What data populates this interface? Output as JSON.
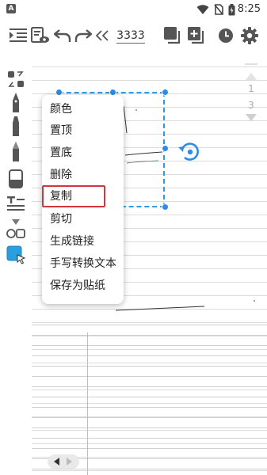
{
  "status_bar": {
    "app_badge": "A",
    "time": "8:25",
    "icons": [
      "wifi-icon",
      "no-sim-icon",
      "battery-icon"
    ]
  },
  "toolbar": {
    "page_number": "3333",
    "icons": [
      "toc-icon",
      "eye-icon",
      "undo-icon",
      "redo-icon",
      "collapse-icon",
      "copy-page-icon",
      "add-page-icon",
      "clock-icon",
      "gear-icon"
    ]
  },
  "tools": [
    "lasso-icon",
    "pen-icon",
    "marker-icon",
    "highlighter-icon",
    "eraser-icon",
    "text-tool-icon",
    "shapes-icon",
    "select-icon"
  ],
  "pager": {
    "top": "1",
    "bottom": "3"
  },
  "context_menu": {
    "items": [
      {
        "label": "颜色"
      },
      {
        "label": "置顶"
      },
      {
        "label": "置底"
      },
      {
        "label": "删除"
      },
      {
        "label": "复制",
        "highlighted": true
      },
      {
        "label": "剪切"
      },
      {
        "label": "生成链接"
      },
      {
        "label": "手写转换文本"
      },
      {
        "label": "保存为贴纸"
      }
    ]
  },
  "colors": {
    "selection": "#2e9be6",
    "highlight": "#d0393b",
    "accent_tool": "#2a9fe0"
  }
}
